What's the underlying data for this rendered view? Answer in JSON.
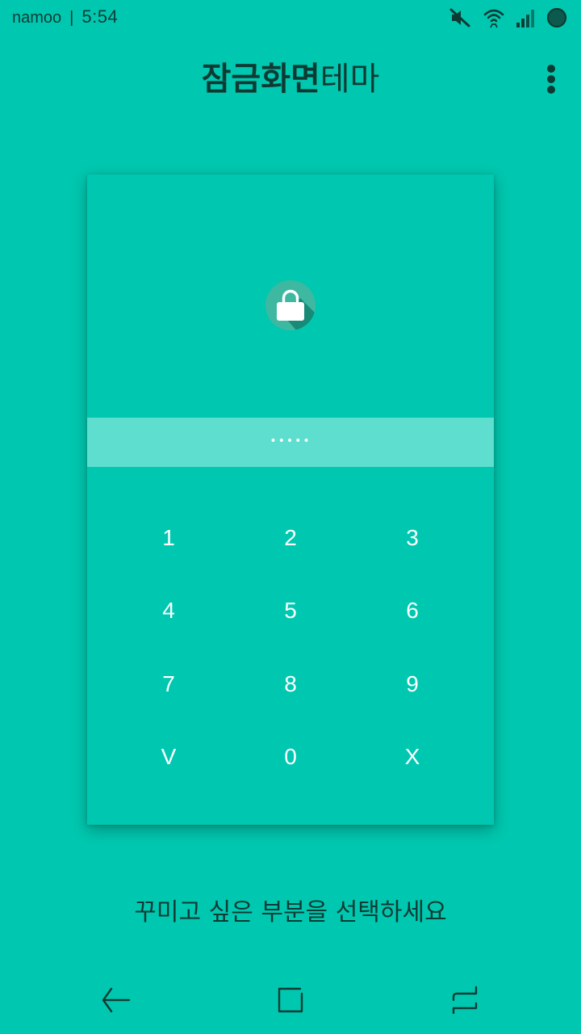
{
  "status_bar": {
    "carrier": "namoo",
    "separator": "|",
    "time": "5:54",
    "icons": [
      "mute-icon",
      "wifi-icon",
      "signal-icon",
      "battery-icon"
    ]
  },
  "header": {
    "title_bold": "잠금화면",
    "title_regular": "테마",
    "menu_icon": "more-vertical-icon"
  },
  "lock_preview": {
    "icon": "lock-icon",
    "password_mask": "•••••",
    "keypad": [
      "1",
      "2",
      "3",
      "4",
      "5",
      "6",
      "7",
      "8",
      "9",
      "V",
      "0",
      "X"
    ]
  },
  "hint": "꾸미고 싶은 부분을 선택하세요",
  "navigation": {
    "buttons": [
      "back-icon",
      "home-icon",
      "recents-icon"
    ]
  },
  "colors": {
    "background": "#00c8b0",
    "password_bar": "#5ddece",
    "dark_text": "#0d3b34",
    "lock_circle": "#3fb8a2",
    "lock_shadow": "#178a78"
  }
}
